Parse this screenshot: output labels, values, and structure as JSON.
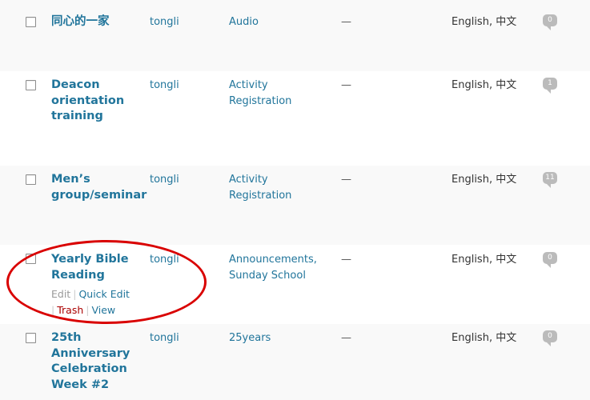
{
  "rows": [
    {
      "title": "同心的一家",
      "author": "tongli",
      "categories": "Audio",
      "tags": "—",
      "languages": "English, 中文",
      "comments": "0"
    },
    {
      "title": "Deacon orientation training",
      "author": "tongli",
      "categories": "Activity Registration",
      "tags": "—",
      "languages": "English, 中文",
      "comments": "1"
    },
    {
      "title": "Men’s group/seminar",
      "author": "tongli",
      "categories": "Activity Registration",
      "tags": "—",
      "languages": "English, 中文",
      "comments": "11"
    },
    {
      "title": "Yearly Bible Reading",
      "author": "tongli",
      "categories": "Announcements, Sunday School",
      "tags": "—",
      "languages": "English, 中文",
      "comments": "0",
      "actions": {
        "edit": "Edit",
        "quick_edit": "Quick Edit",
        "trash": "Trash",
        "view": "View",
        "separator": "|"
      }
    },
    {
      "title": "25th Anniversary Celebration Week #2",
      "author": "tongli",
      "categories": "25years",
      "tags": "—",
      "languages": "English, 中文",
      "comments": "0"
    }
  ],
  "colors": {
    "link": "#21759b",
    "trash": "#aa0000",
    "highlight_ellipse": "#d90000",
    "alt_row": "#f9f9f9",
    "comment_bubble": "#bbbbbb"
  }
}
